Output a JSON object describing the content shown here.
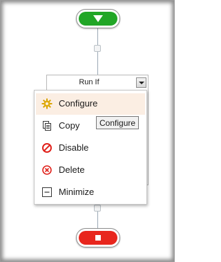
{
  "flow": {
    "start": {
      "icon": "play-down-triangle-icon",
      "color": "#21a626"
    },
    "stop": {
      "icon": "stop-square-icon",
      "color": "#e8261d"
    }
  },
  "block": {
    "title": "Run If",
    "dropdown_icon": "chevron-down-icon"
  },
  "context_menu": {
    "items": [
      {
        "label": "Configure",
        "icon": "gear-icon",
        "highlighted": true
      },
      {
        "label": "Copy",
        "icon": "copy-icon",
        "highlighted": false
      },
      {
        "label": "Disable",
        "icon": "disable-icon",
        "highlighted": false
      },
      {
        "label": "Delete",
        "icon": "delete-icon",
        "highlighted": false
      },
      {
        "label": "Minimize",
        "icon": "minimize-icon",
        "highlighted": false
      }
    ],
    "highlight_color": "#fbeee3"
  },
  "tooltip": {
    "text": "Configure"
  }
}
